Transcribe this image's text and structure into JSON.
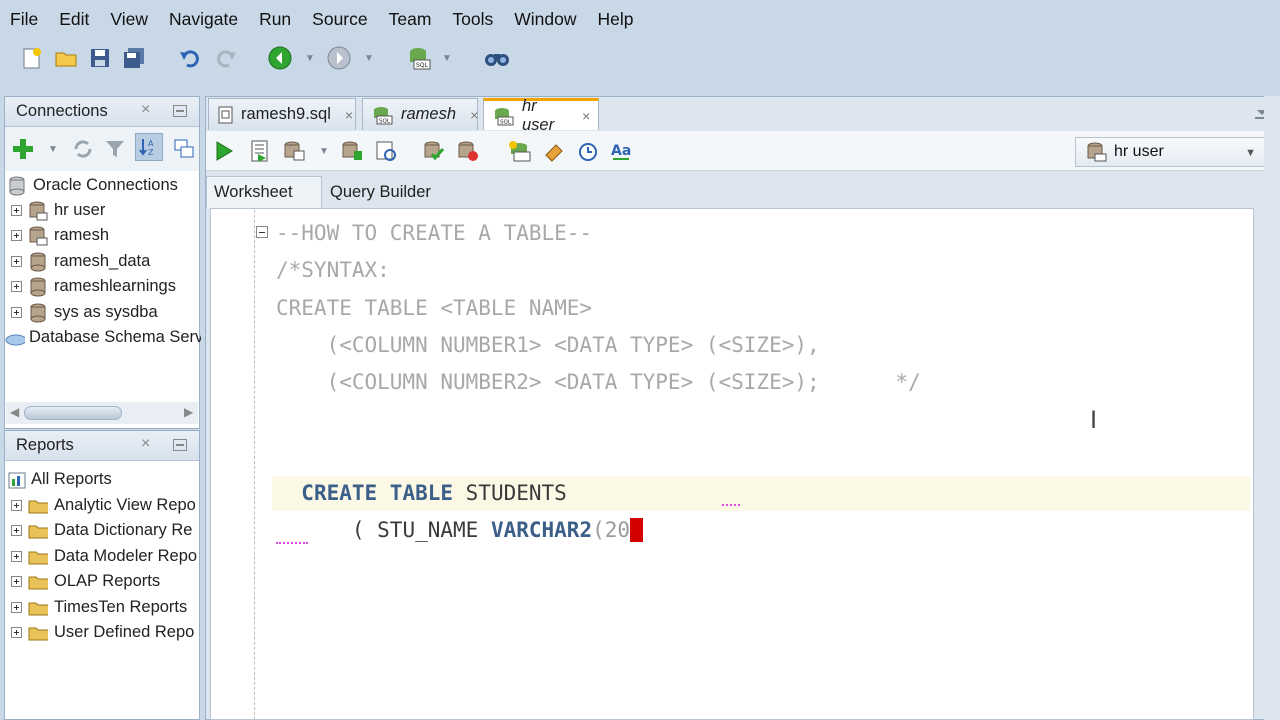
{
  "menu": [
    "File",
    "Edit",
    "View",
    "Navigate",
    "Run",
    "Source",
    "Team",
    "Tools",
    "Window",
    "Help"
  ],
  "main_toolbar": {
    "icons": [
      "new-file-icon",
      "open-folder-icon",
      "save-icon",
      "save-all-icon",
      "undo-icon",
      "redo-icon",
      "back-icon",
      "forward-icon",
      "sql-icon",
      "find-binoculars-icon"
    ]
  },
  "connections_panel": {
    "title": "Connections",
    "close": "×",
    "root": "Oracle Connections",
    "items": [
      {
        "label": "hr user",
        "icon": "database-connected-icon"
      },
      {
        "label": "ramesh",
        "icon": "database-connected-icon"
      },
      {
        "label": "ramesh_data",
        "icon": "database-icon"
      },
      {
        "label": "rameshlearnings",
        "icon": "database-icon"
      },
      {
        "label": "sys as sysdba",
        "icon": "database-icon"
      }
    ],
    "extra": "Database Schema Serv"
  },
  "reports_panel": {
    "title": "Reports",
    "close": "×",
    "root": "All Reports",
    "items": [
      "Analytic View Repo",
      "Data Dictionary Re",
      "Data Modeler Repo",
      "OLAP Reports",
      "TimesTen Reports",
      "User Defined Repo"
    ]
  },
  "doc_tabs": [
    {
      "label": "ramesh9.sql",
      "icon": "sql-file-icon",
      "close": "×",
      "active": false
    },
    {
      "label": "ramesh",
      "icon": "sql-worksheet-icon",
      "close": "×",
      "active": false
    },
    {
      "label": "hr user",
      "icon": "sql-worksheet-icon",
      "close": "×",
      "active": true
    }
  ],
  "editor": {
    "connection": "hr user",
    "sub_tabs": {
      "worksheet": "Worksheet",
      "query_builder": "Query Builder"
    },
    "lines": {
      "l1": "--HOW TO CREATE A TABLE--",
      "l2": "/*SYNTAX:",
      "l3": "CREATE TABLE <TABLE NAME>",
      "l4": "    (<COLUMN NUMBER1> <DATA TYPE> (<SIZE>),",
      "l5": "    (<COLUMN NUMBER2> <DATA TYPE> (<SIZE>);      */",
      "l7_kw": "CREATE TABLE",
      "l7_id": " STUDENTS",
      "l8_a": "    ( STU_NAME ",
      "l8_kw": "VARCHAR2",
      "l8_b": "(20",
      "l8_c": ")"
    }
  },
  "colors": {
    "keyword": "#3c5f89",
    "comment": "#a8a8a8",
    "active_tab_accent": "#f1a300",
    "caret_highlight": "#d40000",
    "chrome_background": "#c9d8e6"
  }
}
